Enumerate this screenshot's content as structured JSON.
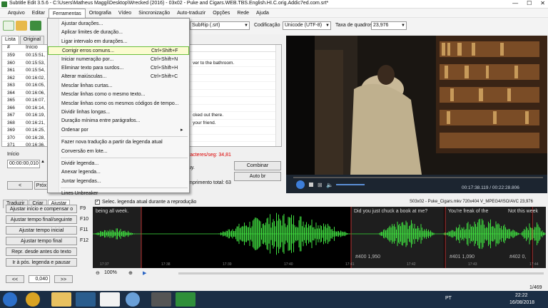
{
  "window": {
    "title": "Subtitle Edit 3.5.6 - C:\\Users\\Matheus Maggi\\Desktop\\Wrecked (2016) - 03x02 - Puke and Cigars.WEB.TBS.English.HI.C.orig.Addic7ed.com.srt*",
    "minimize": "—",
    "maximize": "☐",
    "close": "✕"
  },
  "menubar": [
    "Arquivo",
    "Editar",
    "Ferramentas",
    "Ortografia",
    "Vídeo",
    "Sincronização",
    "Auto-traduzir",
    "Opções",
    "Rede",
    "Ajuda"
  ],
  "toolbar": {
    "format_value": "SubRip (.srt)",
    "encoding_label": "Codificação",
    "encoding_value": "Unicode (UTF-8)",
    "framerate_label": "Taxa de quadros",
    "framerate_value": "23,976"
  },
  "list": {
    "tabs": [
      "Lista",
      "Original"
    ],
    "headers": {
      "num": "#",
      "start": "Início"
    },
    "rows": [
      {
        "num": "359",
        "start": "00:15:51,",
        "text": ""
      },
      {
        "num": "360",
        "start": "00:15:53,",
        "text": "ver to the bathroom."
      },
      {
        "num": "361",
        "start": "00:15:54,",
        "text": ""
      },
      {
        "num": "362",
        "start": "00:16:02,",
        "text": ""
      },
      {
        "num": "363",
        "start": "00:16:05,",
        "text": ""
      },
      {
        "num": "364",
        "start": "00:16:06,",
        "text": ""
      },
      {
        "num": "365",
        "start": "00:16:07,",
        "text": ""
      },
      {
        "num": "366",
        "start": "00:16:14,",
        "text": ""
      },
      {
        "num": "367",
        "start": "00:16:19,",
        "text": "cked out there."
      },
      {
        "num": "368",
        "start": "00:16:21,",
        "text": "your friend."
      },
      {
        "num": "369",
        "start": "00:16:25,",
        "text": ""
      },
      {
        "num": "370",
        "start": "00:16:28,",
        "text": ""
      },
      {
        "num": "371",
        "start": "00:16:36,",
        "text": ""
      },
      {
        "num": "372",
        "start": "00:16:39,",
        "text": ""
      }
    ]
  },
  "edit": {
    "start_label": "Início",
    "start_value": "00:00:00,010",
    "chars_per_sec": "racteres/seg: 34,81",
    "text_preview": "uy.",
    "combine_button": "Combinar",
    "autobr_button": "Auto br",
    "total_length": "mprimento total: 63",
    "prev_button": "<",
    "next_button": "Próx"
  },
  "video": {
    "time": "00:17:38.119 / 00:22:28.806"
  },
  "lower": {
    "tabs": [
      "Traduzir",
      "Criar",
      "Ajustar"
    ],
    "checkbox_label": "Selec. legenda atual durante a reprodução",
    "file_info": "S03x02 - Puke_Cigars.mkv 720x404 V_MPEG4/ISO/AVC 23,976",
    "adjust_buttons": [
      {
        "label": "Ajustar início e compensar o",
        "key": "F9"
      },
      {
        "label": "Ajustar tempo final/seguinte",
        "key": "F10"
      },
      {
        "label": "Ajustar tempo inicial",
        "key": "F11"
      },
      {
        "label": "Ajustar tempo final",
        "key": "F12"
      },
      {
        "label": "Repr. desde antes do texto",
        "key": ""
      },
      {
        "label": "Ir à pós. legenda e pausar",
        "key": ""
      }
    ],
    "step_value": "0,040",
    "step_prev": "<<",
    "step_next": ">>",
    "zoom": "100%",
    "count": "1/469"
  },
  "waveform": {
    "segments": [
      {
        "text": "being all week.",
        "info": ""
      },
      {
        "text": "Did you just chuck a book at me?",
        "info": "#400  1,950"
      },
      {
        "text": "You're freak of the",
        "info": "#401  1,090"
      },
      {
        "text": "Not this week",
        "info": "#402  0,"
      }
    ],
    "ticks": [
      "17:37",
      "17:38",
      "17:39",
      "17:40",
      "17:41",
      "17:42",
      "17:43",
      "17:44"
    ]
  },
  "taskbar": {
    "lang": "PT",
    "time": "22:22",
    "date": "16/08/2018"
  },
  "dropdown": {
    "items": [
      {
        "label": "Ajustar durações...",
        "shortcut": ""
      },
      {
        "label": "Aplicar limites de duração...",
        "shortcut": ""
      },
      {
        "label": "Ligar intervalo em durações...",
        "shortcut": ""
      },
      {
        "label": "Corrigir erros comuns...",
        "shortcut": "Ctrl+Shift+F"
      },
      {
        "label": "Iniciar numeração por...",
        "shortcut": "Ctrl+Shift+N"
      },
      {
        "label": "Eliminar texto para surdos...",
        "shortcut": "Ctrl+Shift+H"
      },
      {
        "label": "Alterar maiúsculas...",
        "shortcut": "Ctrl+Shift+C"
      },
      {
        "label": "Mesclar linhas curtas...",
        "shortcut": ""
      },
      {
        "label": "Mesclar linhas como o mesmo texto...",
        "shortcut": ""
      },
      {
        "label": "Mesclar linhas como os mesmos códigos de tempo...",
        "shortcut": ""
      },
      {
        "label": "Dividir linhas longas...",
        "shortcut": ""
      },
      {
        "label": "Duração mínima entre parágrafos...",
        "shortcut": ""
      },
      {
        "label": "Ordenar por",
        "shortcut": "▸"
      },
      {
        "label": "Fazer nova tradução a partir da legenda atual",
        "shortcut": ""
      },
      {
        "label": "Conversão em lote...",
        "shortcut": ""
      },
      {
        "label": "Dividir legenda...",
        "shortcut": ""
      },
      {
        "label": "Anexar legenda...",
        "shortcut": ""
      },
      {
        "label": "Juntar legendas...",
        "shortcut": ""
      },
      {
        "label": "Lines Unbreaker",
        "shortcut": ""
      }
    ],
    "highlight_index": 3
  },
  "colors": {
    "accent": "#f2c400",
    "highlight_border": "#6cbf3c",
    "wave": "#3fdc3f"
  }
}
